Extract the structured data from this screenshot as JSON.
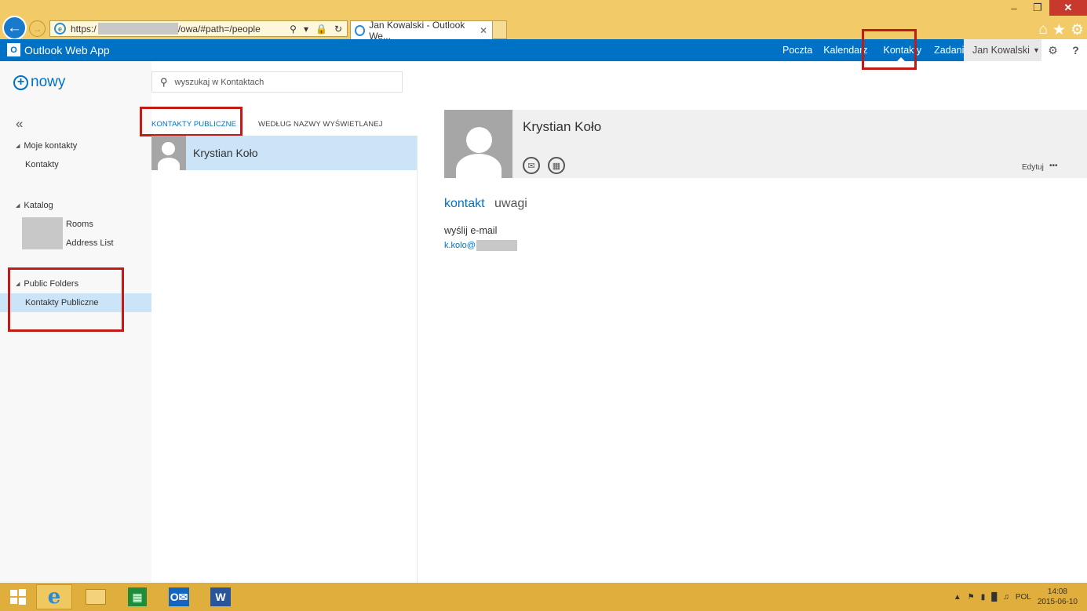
{
  "browser": {
    "address_prefix": "https:/",
    "address_suffix": "/owa/#path=/people",
    "tab_title": "Jan Kowalski - Outlook We...",
    "window_controls": [
      "–",
      "❐",
      "✕"
    ]
  },
  "owa": {
    "app_name": "Outlook Web App",
    "nav": {
      "mail": "Poczta",
      "calendar": "Kalendarz",
      "people": "Kontakty",
      "tasks": "Zadania"
    },
    "user": "Jan Kowalski",
    "new_label": "nowy",
    "search_placeholder": "wyszukaj w Kontaktach"
  },
  "folders": {
    "my_contacts": "Moje kontakty",
    "contacts": "Kontakty",
    "directory": "Katalog",
    "rooms": "Rooms",
    "address_list": "Address List",
    "public_folders": "Public Folders",
    "public_contacts": "Kontakty Publiczne"
  },
  "list": {
    "filter_active": "KONTAKTY PUBLICZNE",
    "filter_sort": "WEDŁUG NAZWY WYŚWIETLANEJ",
    "items": [
      {
        "name": "Krystian Koło"
      }
    ]
  },
  "reading": {
    "name": "Krystian Koło",
    "edit_label": "Edytuj",
    "more_label": "•••",
    "tabs": {
      "contact": "kontakt",
      "notes": "uwagi"
    },
    "send_email_label": "wyślij e-mail",
    "email": "k.kolo@"
  },
  "taskbar": {
    "language": "POL",
    "time": "14:08",
    "date": "2015-06-10"
  },
  "colors": {
    "owa_blue": "#0072c6",
    "highlight": "#cce4f7",
    "annotation_red": "#c11b17",
    "ie_frame": "#f2ca68"
  }
}
